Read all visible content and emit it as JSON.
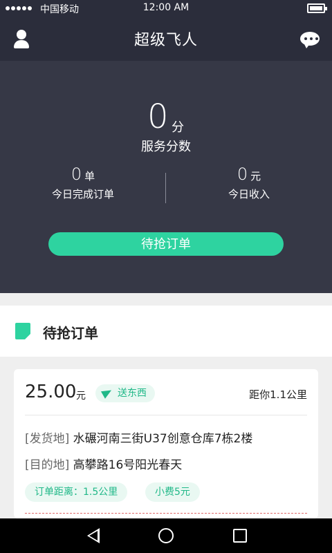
{
  "status_bar": {
    "carrier": "中国移动",
    "time": "12:00 AM"
  },
  "nav": {
    "title": "超级飞人",
    "left_icon": "user-icon",
    "right_icon": "message-icon"
  },
  "hero": {
    "score_value": "0",
    "score_unit": "分",
    "score_label": "服务分数",
    "orders_value": "0",
    "orders_unit": "单",
    "orders_label": "今日完成订单",
    "income_value": "0",
    "income_unit": "元",
    "income_label": "今日收入",
    "grab_button": "待抢订单"
  },
  "section": {
    "title": "待抢订单"
  },
  "order": {
    "price": "25.00",
    "price_unit": "元",
    "type": "送东西",
    "distance_to_you": "距你1.1公里",
    "from_tag": "[发货地]",
    "from_address": "水碾河南三街U37创意仓库7栋2楼",
    "to_tag": "[目的地]",
    "to_address": "高攀路16号阳光春天",
    "order_distance": "订单距离：1.5公里",
    "tip": "小费5元"
  },
  "colors": {
    "header_bg": "#2b2d3b",
    "hero_bg": "#363846",
    "accent": "#2ed3a0",
    "accent_text": "#20b888"
  }
}
